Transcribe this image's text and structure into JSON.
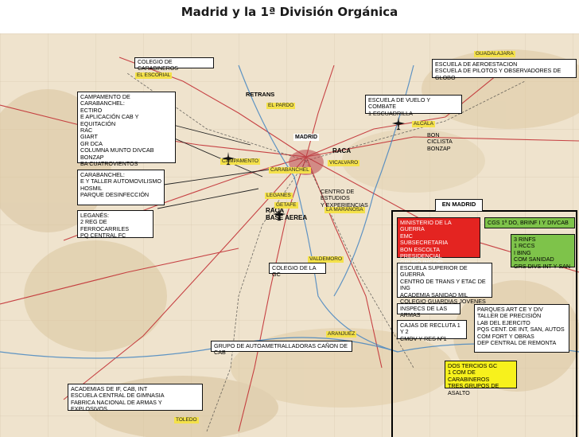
{
  "title": "Madrid y la 1ª División Orgánica",
  "cities": {
    "escorial": "EL ESCORIAL",
    "pardo": "EL PARDO",
    "campamento": "CAMPAMENTO",
    "carabanchel": "CARABANCHEL",
    "leganes": "LEGANES",
    "getafe": "GETAFE",
    "vicalvaro": "VICALVARO",
    "alcala": "ALCALA",
    "guadalajara": "GUADALAJARA",
    "maranosa": "LA MARAÑOSA",
    "valdemoro": "VALDEMORO",
    "aranjuez": "ARANJUEZ",
    "toledo": "TOLEDO",
    "madrid_map": "MADRID"
  },
  "labels": {
    "retrans": "RETRANS",
    "raca_east": "RACA",
    "raca_base": "RACA\nBASE AEREA",
    "en_madrid": "EN MADRID"
  },
  "boxes": {
    "colegio_carabineros": "COLEGIO DE CARABINEROS",
    "aerostacion": "ESCUELA DE AEROESTACION\nESCUELA DE PILOTOS Y OBSERVADORES DE GLOBO",
    "campamento_carabanchel": "CAMPAMENTO DE CARABANCHEL:\nECTIRO\nE APLICACIÓN CAB Y EQUITACIÓN\nRAC\nGIART\nGr DCA\nCOLUMNA MUNTO DIVCAB\nBONZAP\nBA CUATROVIENTOS",
    "vuelo_combate": "ESCUELA DE VUELO Y COMBATE\n1 ESCUADRILLA",
    "bon_ciclista": "BON CICLISTA\nBONZAP",
    "carabanchel": "CARABANCHEL:\nE Y TALLER AUTOMOVILISMO\nHOSMIL\nPARQUE DESINFECCIÓN",
    "leganes": "LEGANÉS:\n2 REG DE FERROCARRILES\nPQ CENTRAL FC",
    "centro_estudios": "CENTRO DE  ESTUDIOS\nY EXPERIENCIAS",
    "colegio_gc": "COLEGIO DE LA GC",
    "autoametralladoras": "GRUPO DE AUTOAMETRALLADORAS CAÑON DE CAB",
    "academias": "ACADEMIAS DE IF, CAB, INT\nESCUELA CENTRAL DE GIMNASIA\nFABRICA NACIONAL DE ARMAS Y EXPLOSIVOS",
    "ministerio": "MINISTERIO DE LA GUERRA\nEMC\nSUBSECRETARIA\nBON ESCOLTA PRESIDENCIAL\nGRUPO INF DEL MINISTERIO",
    "cgs": "CGs 1ª DO, BRINF I Y DIVCAB",
    "rinfs": "3 RINFs\n1 RCCs\nI BING\nCOM SANIDAD\nGRs DIVs INT Y SAN",
    "escuela_superior": "ESCUELA SUPERIOR DE GUERRA\nCENTRO DE TRANS Y ETAC DE ING\nACADEMIA SANIDAD MIL\nCOLEGIO GUARDIAS JOVENES GC",
    "inspecs": "INSPECs DE LAS ARMAS",
    "parques": "PARQUES ART CE Y DIV\nTALLER DE PRECISIÓN\nLAB DEL EJERCITO\nPQs CENT. DE INT, SAN, AUTOS\nCOM FORT Y OBRAS\nDEP CENTRAL DE REMONTA",
    "cajas": "CAJAS DE RECLUTA 1 Y 2\nCMOV Y RES Nº1",
    "tercios": "DOS TERCIOS GC\n1 COM DE CARABINEROS\nTRES GRUPOS DE ASALTO"
  },
  "colors": {
    "ministerio": "#e42421",
    "cgs": "#7ec34a",
    "tercios": "#f7f11c",
    "city_label": "#f4e14a"
  }
}
